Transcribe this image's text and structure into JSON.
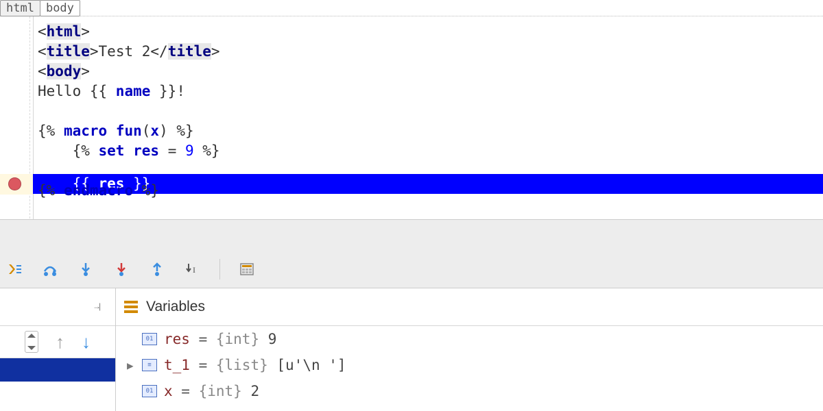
{
  "breadcrumb": [
    "html",
    "body"
  ],
  "code": {
    "l1": {
      "pre": "<",
      "tag": "html",
      "post": ">"
    },
    "l2": {
      "pre": "<",
      "tag": "title",
      "mid": ">",
      "txt": "Test 2",
      "c1": "</",
      "ctag": "title",
      "c2": ">"
    },
    "l3": {
      "pre": "<",
      "tag": "body",
      "post": ">"
    },
    "l4": {
      "txt": "Hello ",
      "o": "{{ ",
      "var": "name",
      "c": " }}",
      "excl": "!"
    },
    "l5": "",
    "l6": {
      "o": "{% ",
      "k": "macro",
      "sp": " ",
      "fn": "fun",
      "p1": "(",
      "x": "x",
      "p2": ")",
      "c": " %}"
    },
    "l7": {
      "ind": "    ",
      "o": "{% ",
      "k": "set",
      "sp": " ",
      "var": "res",
      "eq": " = ",
      "num": "9",
      "c": " %}"
    },
    "l8": {
      "ind": "    ",
      "o": "{{ ",
      "var": "res",
      "c": " }}"
    },
    "l9": {
      "o": "{% ",
      "k": "endmacro",
      "c": " %}"
    }
  },
  "variablesTitle": "Variables",
  "vars": [
    {
      "name": "res",
      "type": "{int}",
      "value": "9",
      "ico": "10"
    },
    {
      "name": "t_1",
      "type": "{list}",
      "value": "[u'\\n    ']",
      "ico": "123",
      "expandable": true
    },
    {
      "name": "x",
      "type": "{int}",
      "value": "2",
      "ico": "10"
    }
  ]
}
